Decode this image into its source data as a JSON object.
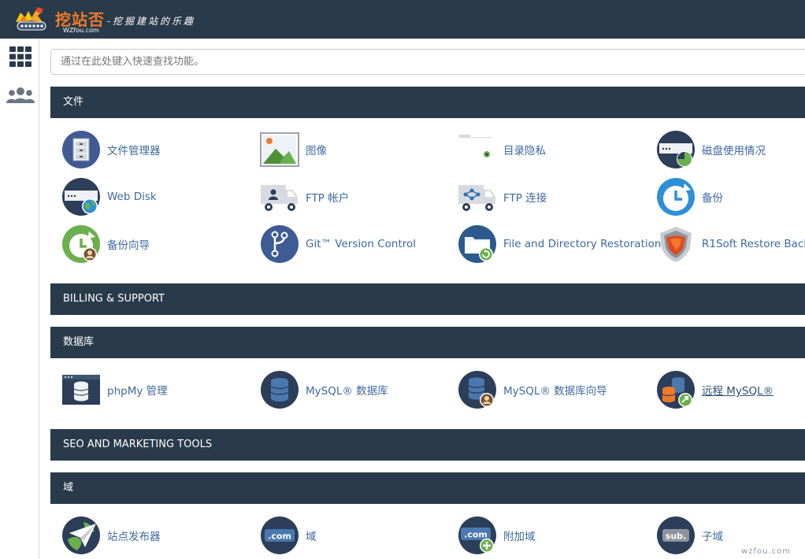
{
  "header": {
    "logo_cn": "挖站否",
    "logo_sub": "WZfou.com",
    "slogan": "-挖掘建站的乐趣"
  },
  "nav": {
    "apps_icon": "grid-icon",
    "users_icon": "users-icon"
  },
  "search": {
    "placeholder": "通过在此处键入快速查找功能。"
  },
  "sections": {
    "files": {
      "title": "文件",
      "items": [
        {
          "label": "文件管理器",
          "icon": "file-manager-icon"
        },
        {
          "label": "图像",
          "icon": "images-icon"
        },
        {
          "label": "目录隐私",
          "icon": "directory-privacy-icon"
        },
        {
          "label": "磁盘使用情况",
          "icon": "disk-usage-icon"
        },
        {
          "label": "Web Disk",
          "icon": "web-disk-icon"
        },
        {
          "label": "FTP 帐户",
          "icon": "ftp-accounts-icon"
        },
        {
          "label": "FTP 连接",
          "icon": "ftp-connections-icon"
        },
        {
          "label": "备份",
          "icon": "backup-icon"
        },
        {
          "label": "备份向导",
          "icon": "backup-wizard-icon"
        },
        {
          "label": "Git™ Version Control",
          "icon": "git-icon"
        },
        {
          "label": "File and Directory Restoration",
          "icon": "restore-folder-icon"
        },
        {
          "label": "R1Soft Restore Back",
          "icon": "r1soft-shield-icon"
        }
      ]
    },
    "billing": {
      "title": "BILLING & SUPPORT"
    },
    "databases": {
      "title": "数据库",
      "items": [
        {
          "label": "phpMy 管理",
          "icon": "phpmyadmin-icon"
        },
        {
          "label": "MySQL® 数据库",
          "icon": "mysql-database-icon"
        },
        {
          "label": "MySQL® 数据库向导",
          "icon": "mysql-wizard-icon"
        },
        {
          "label": "远程 MySQL®",
          "icon": "remote-mysql-icon"
        }
      ]
    },
    "seo": {
      "title": "SEO AND MARKETING TOOLS"
    },
    "domains": {
      "title": "域",
      "items": [
        {
          "label": "站点发布器",
          "icon": "site-publisher-icon"
        },
        {
          "label": "域",
          "icon": "domains-icon"
        },
        {
          "label": "附加域",
          "icon": "addon-domains-icon"
        },
        {
          "label": "子域",
          "icon": "subdomains-icon"
        }
      ]
    }
  },
  "watermark": "wzfou.com",
  "colors": {
    "header_bg": "#293a4a",
    "link": "#3d6a9c",
    "icon_navy": "#2c3e58",
    "icon_green": "#6ab04c",
    "icon_blue": "#2f8fd6",
    "accent_orange": "#f07a2a"
  }
}
